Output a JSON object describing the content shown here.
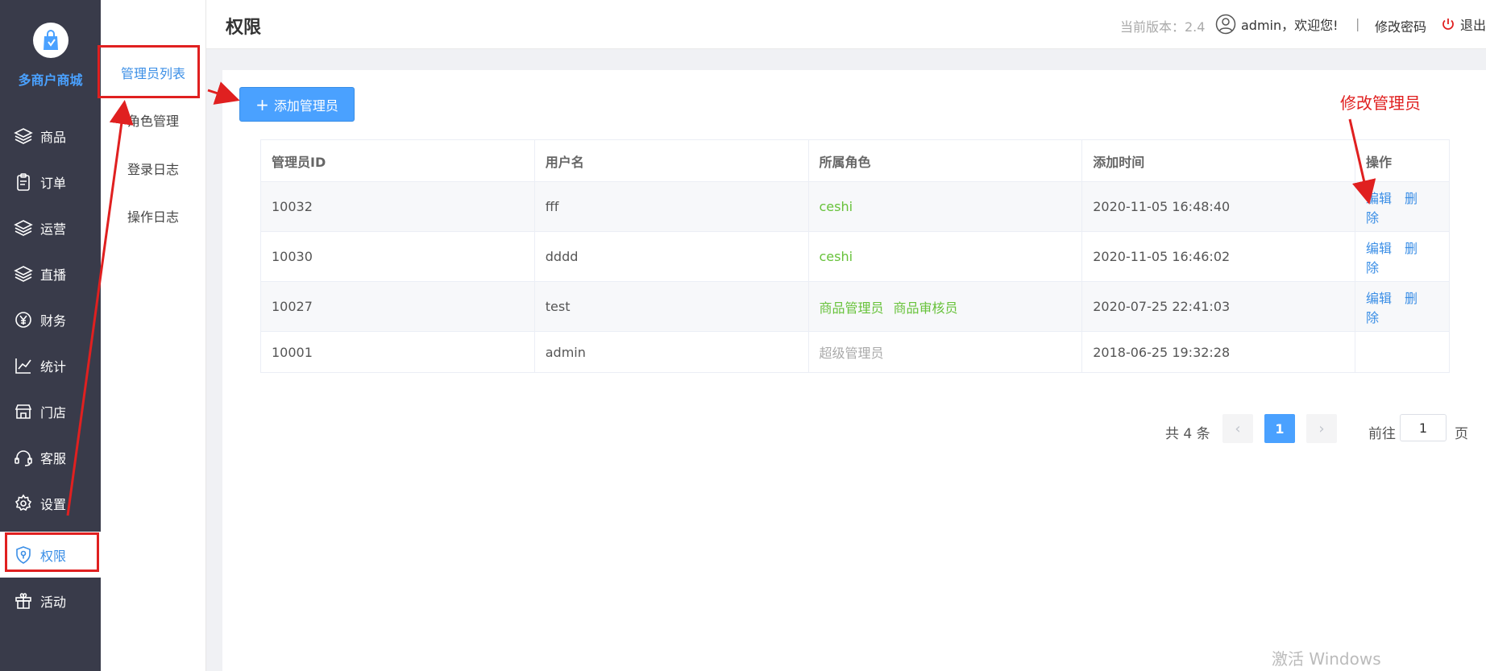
{
  "brand": {
    "name": "多商户商城"
  },
  "sidebar": {
    "items": [
      {
        "label": "商品",
        "icon": "layers-icon"
      },
      {
        "label": "订单",
        "icon": "clipboard-icon"
      },
      {
        "label": "运营",
        "icon": "layers-icon"
      },
      {
        "label": "直播",
        "icon": "layers-icon"
      },
      {
        "label": "财务",
        "icon": "yen-icon"
      },
      {
        "label": "统计",
        "icon": "line-chart-icon"
      },
      {
        "label": "门店",
        "icon": "store-icon"
      },
      {
        "label": "客服",
        "icon": "headset-icon"
      },
      {
        "label": "设置",
        "icon": "gear-icon"
      },
      {
        "label": "权限",
        "icon": "shield-icon",
        "active": true
      },
      {
        "label": "活动",
        "icon": "gift-icon"
      }
    ]
  },
  "subnav": {
    "items": [
      {
        "label": "管理员列表",
        "active": true
      },
      {
        "label": "角色管理"
      },
      {
        "label": "登录日志"
      },
      {
        "label": "操作日志"
      }
    ]
  },
  "header": {
    "title": "权限",
    "version": "当前版本：2.4",
    "user": "admin，欢迎您!",
    "separator": "|",
    "change_password": "修改密码",
    "logout": "退出"
  },
  "toolbar": {
    "add_label": "添加管理员",
    "add_icon": "plus-icon"
  },
  "table": {
    "headers": [
      "管理员ID",
      "用户名",
      "所属角色",
      "添加时间",
      "操作"
    ],
    "rows": [
      {
        "id": "10032",
        "username": "fff",
        "roles": [
          "ceshi"
        ],
        "time": "2020-11-05 16:48:40",
        "edit": "编辑",
        "delete": "删除"
      },
      {
        "id": "10030",
        "username": "dddd",
        "roles": [
          "ceshi"
        ],
        "time": "2020-11-05 16:46:02",
        "edit": "编辑",
        "delete": "删除"
      },
      {
        "id": "10027",
        "username": "test",
        "roles": [
          "商品管理员",
          "商品审核员"
        ],
        "time": "2020-07-25 22:41:03",
        "edit": "编辑",
        "delete": "删除"
      },
      {
        "id": "10001",
        "username": "admin",
        "roles": [
          "超级管理员"
        ],
        "time": "2018-06-25 19:32:28"
      }
    ]
  },
  "pagination": {
    "total": "共 4 条",
    "current": "1",
    "goto_label": "前往",
    "goto_value": "1",
    "page_suffix": "页"
  },
  "annotation": {
    "text": "修改管理员",
    "color": "#e02020"
  },
  "watermark": "激活 Windows",
  "colors": {
    "primary": "#4aa1ff",
    "sidebar_bg": "#393b4a",
    "role_green": "#67c23a",
    "annotation_red": "#e02020"
  }
}
